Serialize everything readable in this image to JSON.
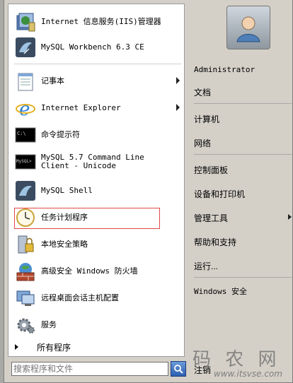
{
  "left_items": [
    {
      "label": "Internet 信息服务(IIS)管理器",
      "icon": "iis-manager-icon",
      "arrow": false
    },
    {
      "label": "MySQL Workbench 6.3 CE",
      "icon": "mysql-dolphin-icon",
      "arrow": false
    },
    {
      "label": "记事本",
      "icon": "notepad-icon",
      "arrow": true
    },
    {
      "label": "Internet Explorer",
      "icon": "internet-explorer-icon",
      "arrow": true
    },
    {
      "label": "命令提示符",
      "icon": "command-prompt-icon",
      "arrow": false
    },
    {
      "label": "MySQL 5.7 Command Line\nClient - Unicode",
      "icon": "mysql-console-icon",
      "arrow": false
    },
    {
      "label": "MySQL Shell",
      "icon": "mysql-dolphin-icon",
      "arrow": false
    },
    {
      "label": "任务计划程序",
      "icon": "task-scheduler-clock-icon",
      "arrow": false
    },
    {
      "label": "本地安全策略",
      "icon": "local-security-policy-icon",
      "arrow": false
    },
    {
      "label": "高级安全 Windows 防火墙",
      "icon": "firewall-icon",
      "arrow": false
    },
    {
      "label": "远程桌面会话主机配置",
      "icon": "remote-desktop-config-icon",
      "arrow": false
    },
    {
      "label": "服务",
      "icon": "services-gear-icon",
      "arrow": false
    }
  ],
  "all_programs": "所有程序",
  "search": {
    "placeholder": "搜索程序和文件",
    "value": ""
  },
  "user": {
    "name": "Administrator"
  },
  "right_items": [
    {
      "label": "文档",
      "arrow": false
    },
    {
      "label": "计算机",
      "arrow": false
    },
    {
      "label": "网络",
      "arrow": false
    },
    {
      "label": "控制面板",
      "arrow": false
    },
    {
      "label": "设备和打印机",
      "arrow": false
    },
    {
      "label": "管理工具",
      "arrow": true
    },
    {
      "label": "帮助和支持",
      "arrow": false
    },
    {
      "label": "运行...",
      "arrow": false
    },
    {
      "label": "Windows 安全",
      "arrow": false
    }
  ],
  "shutdown_label": "注销",
  "watermark": {
    "main": "码 农 网",
    "sub": "www.itsvse.com"
  },
  "colors": {
    "highlight_border": "#e04848",
    "search_button": "#2b5eb3"
  }
}
